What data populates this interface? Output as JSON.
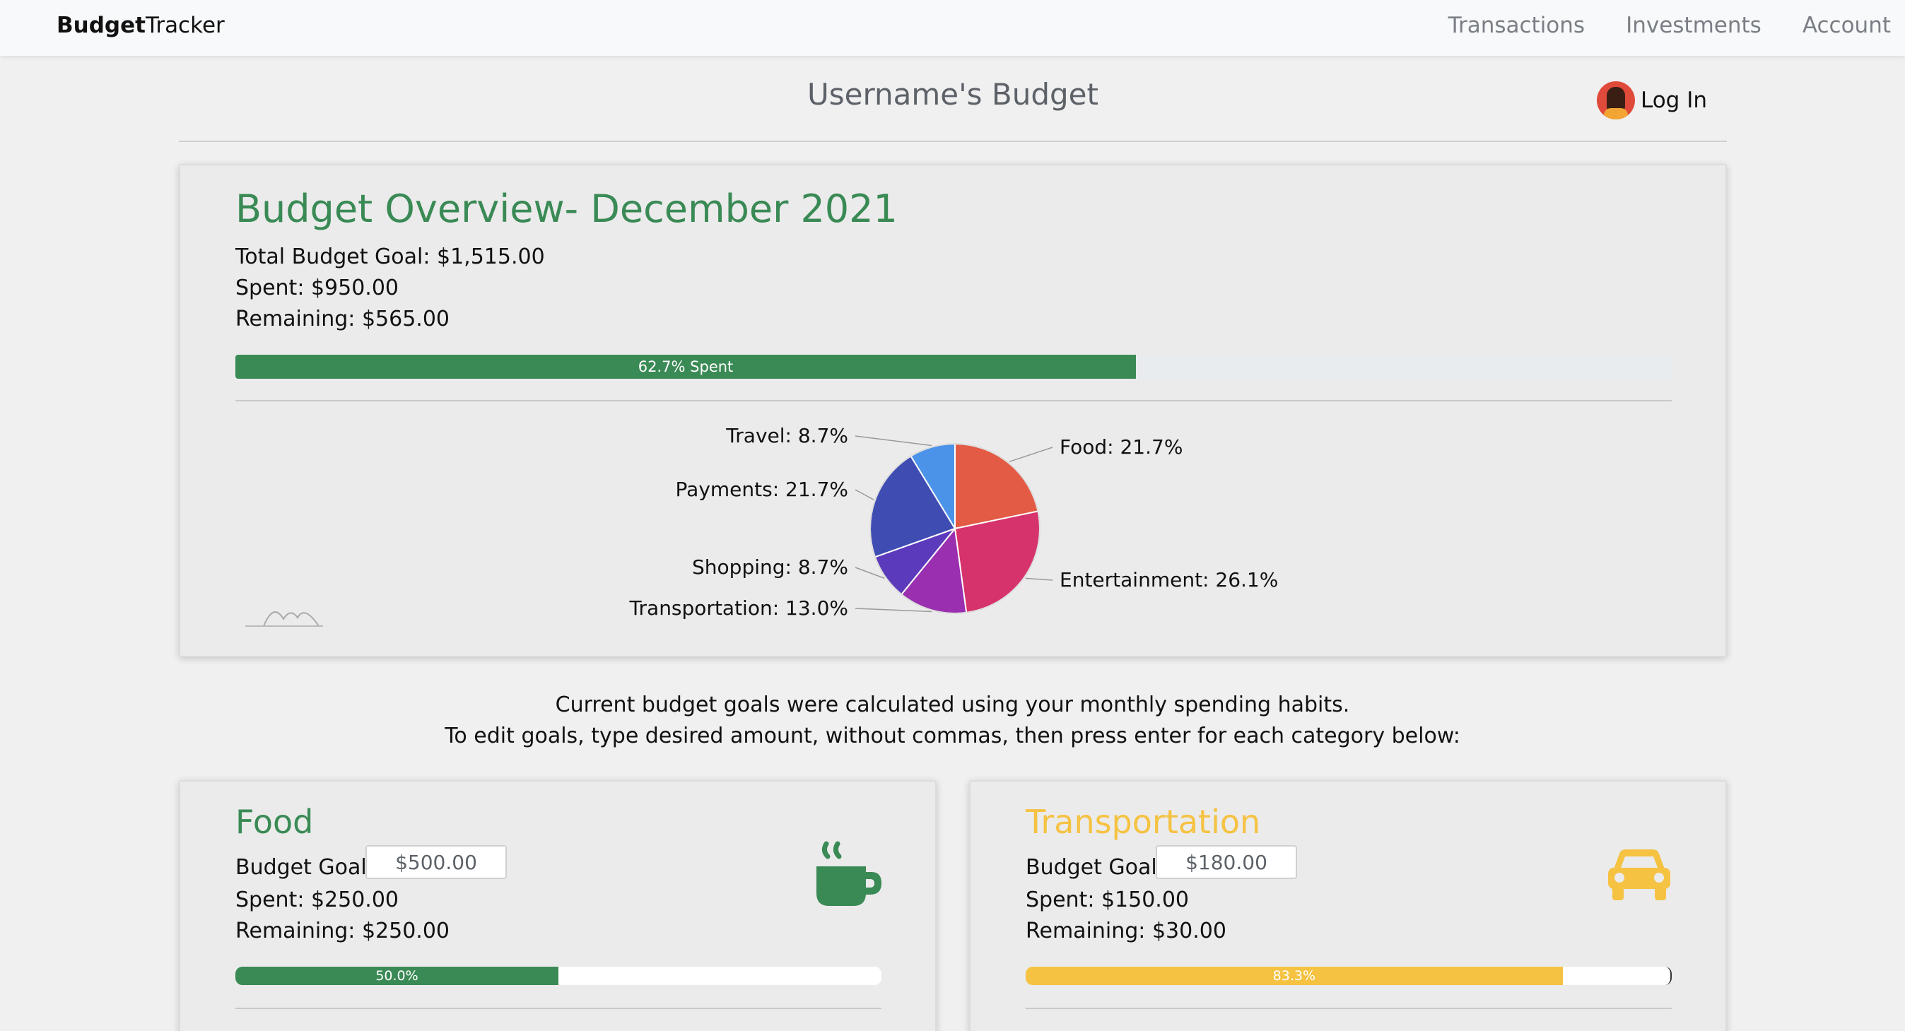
{
  "nav": {
    "brand_bold": "Budget",
    "brand_rest": "Tracker",
    "links": [
      "Transactions",
      "Investments",
      "Account"
    ]
  },
  "header": {
    "title": "Username's Budget",
    "login_label": "Log In"
  },
  "overview": {
    "title": "Budget Overview- December 2021",
    "total_goal": "Total Budget Goal: $1,515.00",
    "spent": "Spent: $950.00",
    "remaining": "Remaining: $565.00",
    "progress_label": "62.7% Spent",
    "progress_fraction": 0.627,
    "progress_color": "#3a8a55"
  },
  "chart_data": {
    "type": "pie",
    "slices": [
      {
        "label": "Food: 21.7%",
        "value": 21.7,
        "color": "#e35a45"
      },
      {
        "label": "Entertainment: 26.1%",
        "value": 26.1,
        "color": "#d6336c"
      },
      {
        "label": "Transportation: 13.0%",
        "value": 13.0,
        "color": "#9a2fb0"
      },
      {
        "label": "Shopping: 8.7%",
        "value": 8.7,
        "color": "#5b3bbb"
      },
      {
        "label": "Payments: 21.7%",
        "value": 21.7,
        "color": "#3f4db3"
      },
      {
        "label": "Travel: 8.7%",
        "value": 8.7,
        "color": "#4a93e8"
      }
    ]
  },
  "notes": {
    "line1": "Current budget goals were calculated using your monthly spending habits.",
    "line2": "To edit goals, type desired amount, without commas, then press enter for each category below:"
  },
  "categories": [
    {
      "title": "Food",
      "color": "#3a8a55",
      "goal_label": "Budget Goal:",
      "goal_value": "$500.00",
      "spent": "Spent: $250.00",
      "remaining": "Remaining: $250.00",
      "progress_label": "50.0%",
      "progress_fraction": 0.5,
      "icon": "coffee-cup-icon"
    },
    {
      "title": "Transportation",
      "color": "#f5c242",
      "goal_label": "Budget Goal:",
      "goal_value": "$180.00",
      "spent": "Spent: $150.00",
      "remaining": "Remaining: $30.00",
      "progress_label": "83.3%",
      "progress_fraction": 0.833,
      "icon": "car-icon"
    }
  ]
}
